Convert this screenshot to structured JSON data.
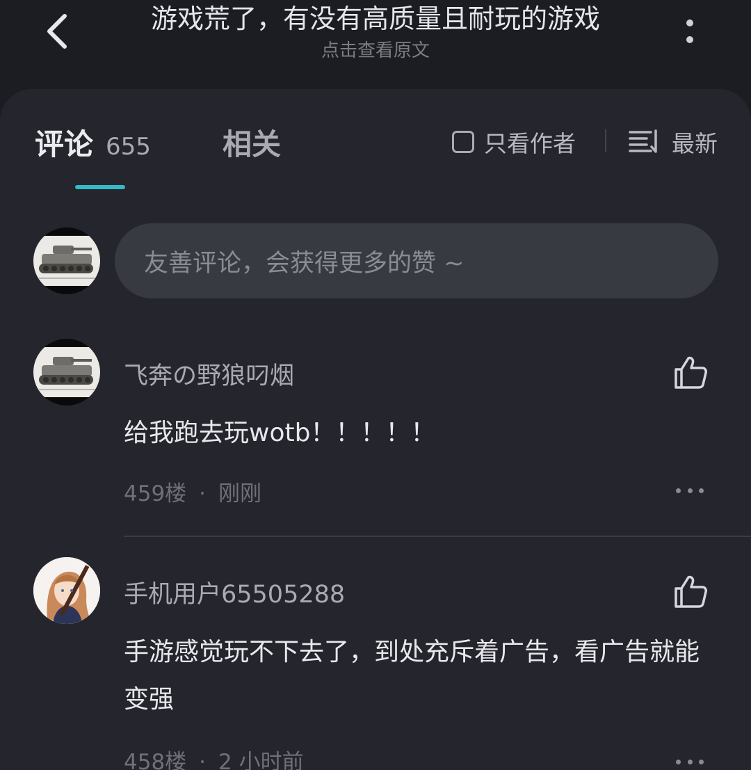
{
  "header": {
    "title": "游戏荒了，有没有高质量且耐玩的游戏",
    "subtitle": "点击查看原文"
  },
  "tabs": {
    "comments_label": "评论",
    "comments_count": "655",
    "related_label": "相关"
  },
  "filters": {
    "only_author_label": "只看作者",
    "sort_label": "最新"
  },
  "composer": {
    "placeholder": "友善评论，会获得更多的赞 ~"
  },
  "comments": [
    {
      "username": "飞奔の野狼叼烟",
      "text": "给我跑去玩wotb！！！！！",
      "floor": "459楼",
      "time": "刚刚",
      "avatar": "tank-avatar"
    },
    {
      "username": "手机用户65505288",
      "text": "手游感觉玩不下去了，到处充斥着广告，看广告就能变强",
      "floor": "458楼",
      "time": "2 小时前",
      "avatar": "anime-girl-avatar"
    }
  ],
  "colors": {
    "background": "#1c1d22",
    "panel": "#25262d",
    "accent": "#35b8c8",
    "input": "#383a42"
  },
  "icons": [
    "back-arrow-icon",
    "more-vertical-icon",
    "checkbox-icon",
    "sort-icon",
    "thumbs-up-icon",
    "more-horizontal-icon"
  ]
}
